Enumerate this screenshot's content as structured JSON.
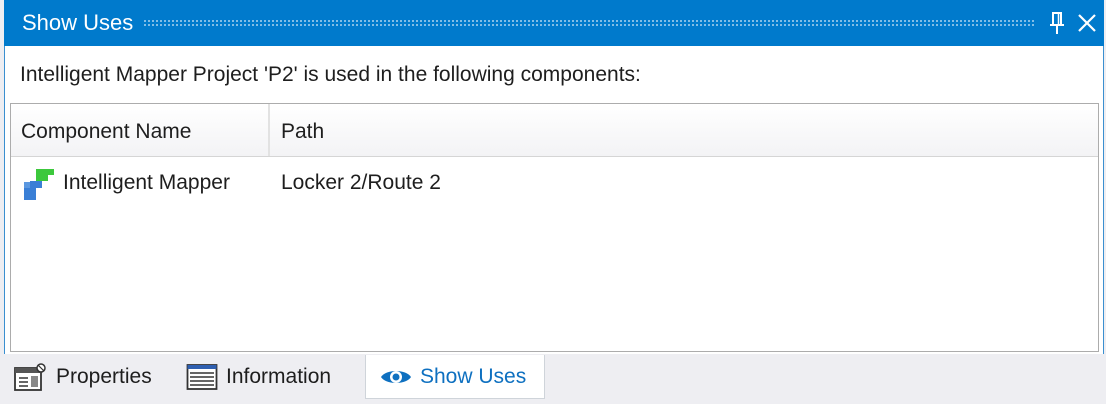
{
  "panel": {
    "title": "Show Uses",
    "description": "Intelligent Mapper Project 'P2' is used in the following components:"
  },
  "grid": {
    "columns": [
      "Component Name",
      "Path"
    ],
    "rows": [
      {
        "name": "Intelligent Mapper",
        "path": "Locker 2/Route 2",
        "icon": "intelligent-mapper-icon"
      }
    ]
  },
  "tabs": [
    {
      "label": "Properties",
      "icon": "properties-icon"
    },
    {
      "label": "Information",
      "icon": "information-icon"
    },
    {
      "label": "Show Uses",
      "icon": "eye-icon",
      "active": true
    }
  ],
  "colors": {
    "accent": "#007acc",
    "active_tab_text": "#0e70c0",
    "icon_green": "#3cc83c",
    "icon_blue": "#3a7fd6"
  }
}
